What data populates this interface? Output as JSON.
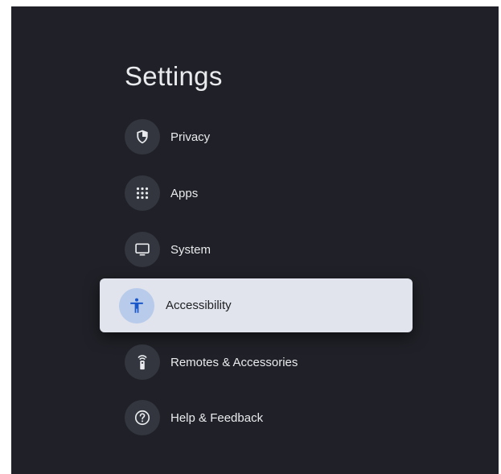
{
  "header": {
    "title": "Settings"
  },
  "menu": {
    "items": [
      {
        "label": "Privacy",
        "icon": "shield-icon"
      },
      {
        "label": "Apps",
        "icon": "apps-grid-icon"
      },
      {
        "label": "System",
        "icon": "monitor-icon"
      },
      {
        "label": "Accessibility",
        "icon": "accessibility-icon",
        "selected": true
      },
      {
        "label": "Remotes & Accessories",
        "icon": "remote-icon"
      },
      {
        "label": "Help & Feedback",
        "icon": "help-icon"
      }
    ]
  },
  "colors": {
    "background": "#202128",
    "icon_bg": "#33363e",
    "selected_bg": "#e1e4ec",
    "selected_icon_bg": "#b9cbeb",
    "accent": "#1a57c8"
  }
}
